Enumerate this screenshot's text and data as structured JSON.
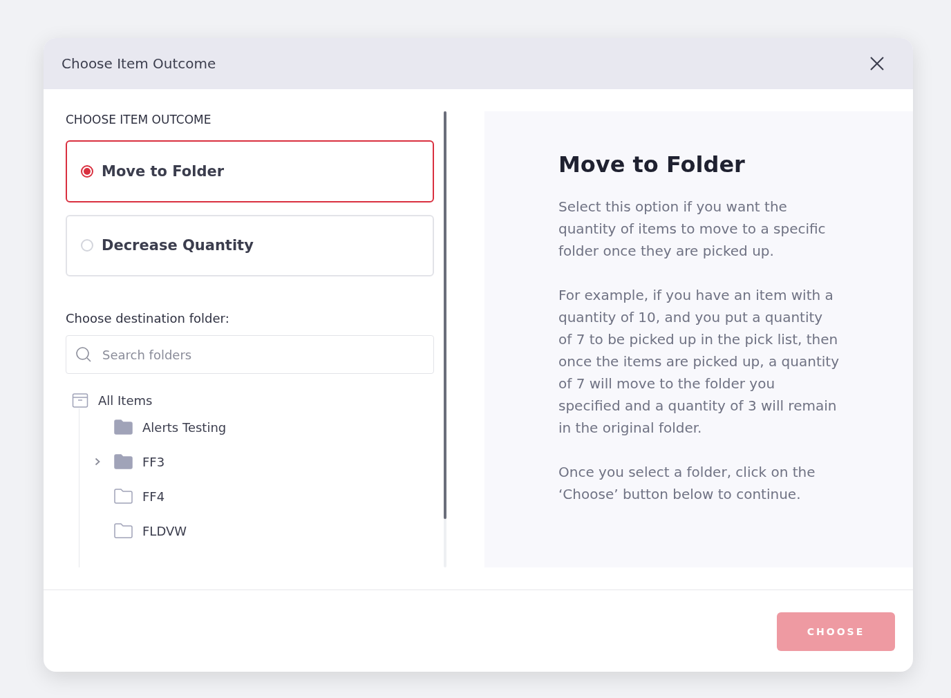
{
  "dialog": {
    "title": "Choose Item Outcome"
  },
  "outcome": {
    "heading": "CHOOSE ITEM OUTCOME",
    "options": [
      {
        "label": "Move to Folder",
        "selected": true
      },
      {
        "label": "Decrease Quantity",
        "selected": false
      }
    ]
  },
  "destination": {
    "label": "Choose destination folder:",
    "search": {
      "placeholder": "Search folders"
    },
    "tree": {
      "label": "All Items",
      "children": [
        {
          "label": "Alerts Testing",
          "kind": "filled",
          "has_children": false
        },
        {
          "label": "FF3",
          "kind": "filled",
          "has_children": true
        },
        {
          "label": "FF4",
          "kind": "empty",
          "has_children": false
        },
        {
          "label": "FLDVW",
          "kind": "empty",
          "has_children": false
        }
      ]
    }
  },
  "help": {
    "title": "Move to Folder",
    "paragraphs": [
      "Select this option if you want the quantity of items to move to a specific folder once they are picked up.",
      "For example, if you have an item with a quantity of 10, and you put a quantity of 7 to be picked up in the pick list, then once the items are picked up, a quantity of 7 will move to the folder you specified and a quantity of 3 will remain in the original folder.",
      "Once you select a folder, click on the ‘Choose’ button below to continue."
    ]
  },
  "footer": {
    "button": {
      "label": "CHOOSE",
      "disabled": true
    }
  }
}
